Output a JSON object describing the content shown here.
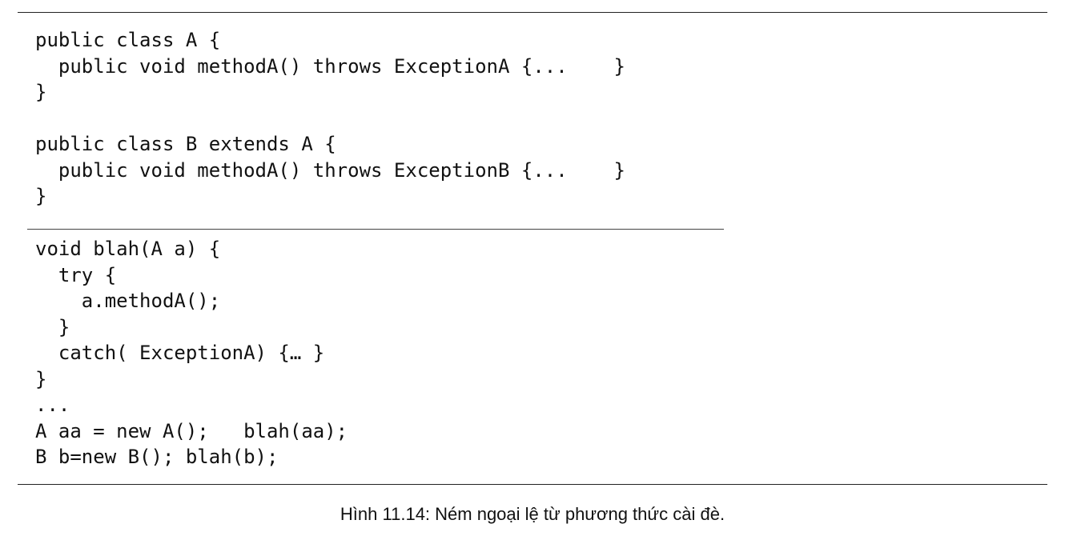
{
  "code_block_1": {
    "lines": [
      "public class A {",
      "  public void methodA() throws ExceptionA {...    }",
      "}",
      "",
      "public class B extends A {",
      "  public void methodA() throws ExceptionB {...    }",
      "}"
    ]
  },
  "code_block_2": {
    "lines": [
      "void blah(A a) {",
      "  try {",
      "    a.methodA();",
      "  }",
      "  catch( ExceptionA) {… }",
      "}",
      "...",
      "A aa = new A();   blah(aa);",
      "B b=new B(); blah(b);"
    ]
  },
  "caption": "Hình 11.14: Ném ngoại lệ từ phương thức cài đè."
}
